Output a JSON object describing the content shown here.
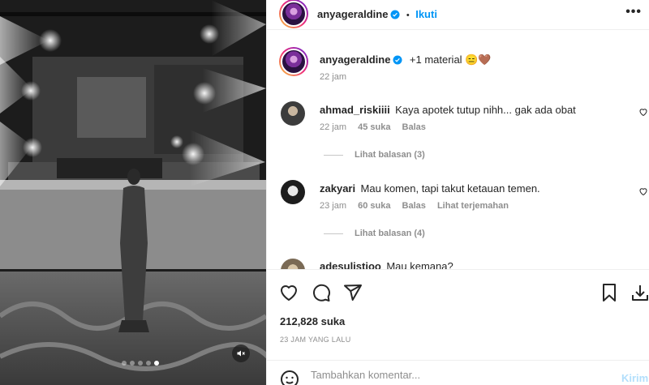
{
  "post": {
    "author": "anyageraldine",
    "follow_separator": "•",
    "follow_label": "Ikuti",
    "more_label": "•••",
    "caption": "+1 material 😑🤎",
    "caption_time": "22 jam",
    "likes": "212,828 suka",
    "posted_ago": "23 JAM YANG LALU",
    "media": {
      "slide_count": 5,
      "active_slide": 5,
      "muted": true
    }
  },
  "comments": [
    {
      "username": "ahmad_riskiiii",
      "text": "Kaya apotek tutup nihh... gak ada obat",
      "time": "22 jam",
      "likes": "45 suka",
      "reply": "Balas",
      "translate": "",
      "view_replies": "Lihat balasan (3)"
    },
    {
      "username": "zakyari",
      "text": "Mau komen, tapi takut ketauan temen.",
      "time": "23 jam",
      "likes": "60 suka",
      "reply": "Balas",
      "translate": "Lihat terjemahan",
      "view_replies": "Lihat balasan (4)"
    },
    {
      "username": "adesulistioo",
      "text": "Mau kemana?"
    }
  ],
  "composer": {
    "placeholder": "Tambahkan komentar...",
    "post_label": "Kirim"
  },
  "icons": {
    "like": "heart-icon",
    "comment": "comment-icon",
    "share": "share-icon",
    "save": "bookmark-icon",
    "download": "download-icon",
    "emoji": "emoji-icon",
    "mute": "speaker-muted-icon"
  },
  "colors": {
    "accent": "#0095f6",
    "verified": "#0095f6",
    "muted_text": "#8e8e8e",
    "post_disabled": "#b2dffc"
  }
}
